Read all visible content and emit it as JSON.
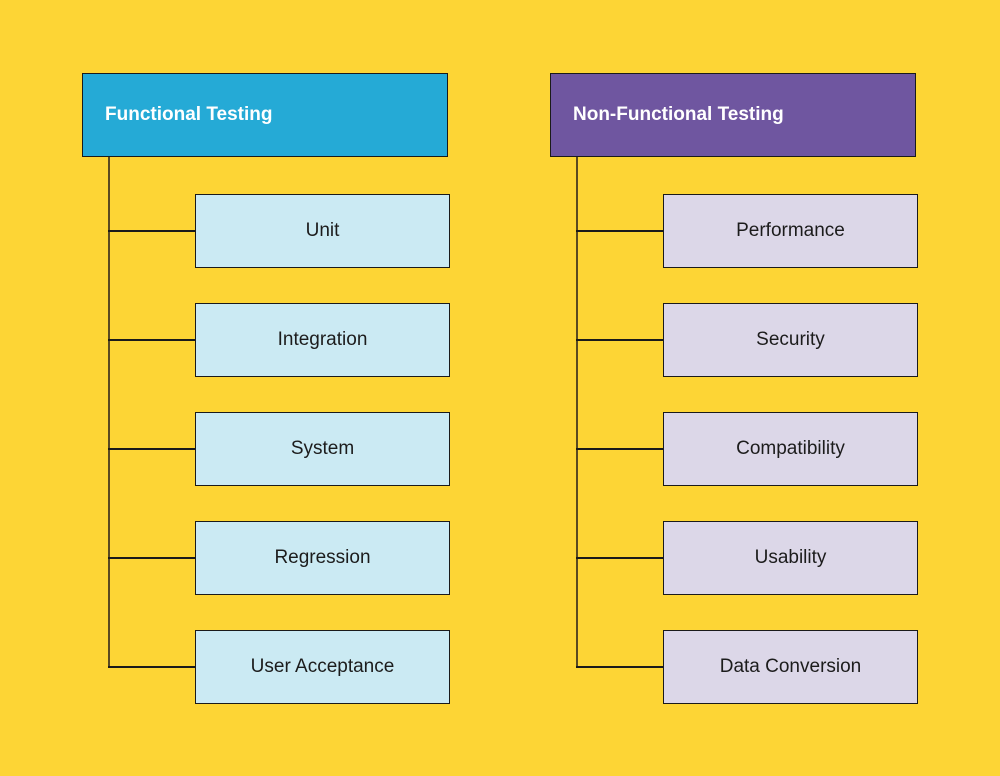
{
  "colors": {
    "background": "#fdd535",
    "functional_header": "#25aad6",
    "functional_child": "#cbeaf3",
    "nonfunctional_header": "#6f56a0",
    "nonfunctional_child": "#dcd7e8"
  },
  "columns": [
    {
      "title": "Functional Testing",
      "items": [
        "Unit",
        "Integration",
        "System",
        "Regression",
        "User Acceptance"
      ]
    },
    {
      "title": "Non-Functional Testing",
      "items": [
        "Performance",
        "Security",
        "Compatibility",
        "Usability",
        "Data Conversion"
      ]
    }
  ]
}
